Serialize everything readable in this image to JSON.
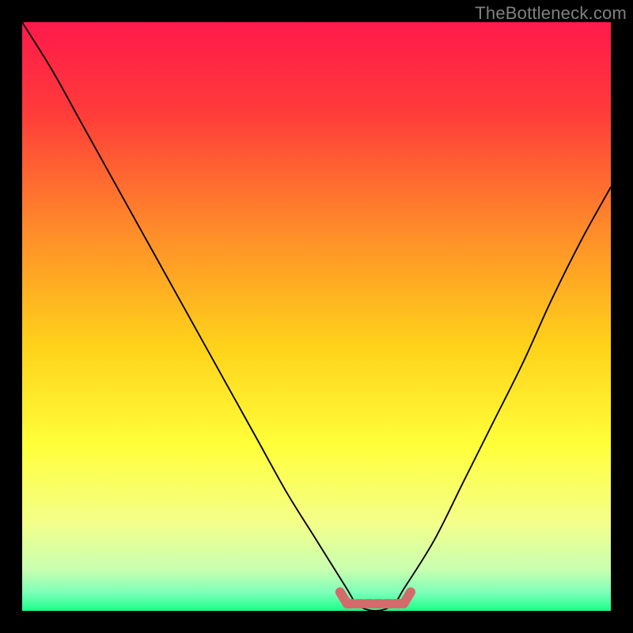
{
  "watermark": "TheBottleneck.com",
  "chart_data": {
    "type": "line",
    "title": "",
    "xlabel": "",
    "ylabel": "",
    "xlim": [
      0,
      100
    ],
    "ylim": [
      0,
      100
    ],
    "line": {
      "name": "bottleneck-curve",
      "x": [
        0,
        5,
        10,
        15,
        20,
        25,
        30,
        35,
        40,
        45,
        50,
        55,
        57,
        60,
        63,
        65,
        70,
        75,
        80,
        85,
        90,
        95,
        100
      ],
      "y": [
        100,
        92,
        83,
        74,
        65,
        56,
        47,
        38,
        29,
        20,
        12,
        4,
        1,
        0,
        1,
        4,
        12,
        22,
        32,
        42,
        53,
        63,
        72
      ]
    },
    "flat_marker": {
      "name": "optimal-zone",
      "x_start": 54,
      "x_end": 66,
      "y": 1.2,
      "color": "#d46a6a"
    },
    "gradient_stops": [
      {
        "offset": 0.0,
        "color": "#ff1a4b"
      },
      {
        "offset": 0.15,
        "color": "#ff3a3a"
      },
      {
        "offset": 0.35,
        "color": "#ff8a2a"
      },
      {
        "offset": 0.55,
        "color": "#ffd21a"
      },
      {
        "offset": 0.72,
        "color": "#ffff3a"
      },
      {
        "offset": 0.85,
        "color": "#f4ff8a"
      },
      {
        "offset": 0.93,
        "color": "#c8ffb0"
      },
      {
        "offset": 0.97,
        "color": "#7affb8"
      },
      {
        "offset": 1.0,
        "color": "#1aff8a"
      }
    ]
  }
}
